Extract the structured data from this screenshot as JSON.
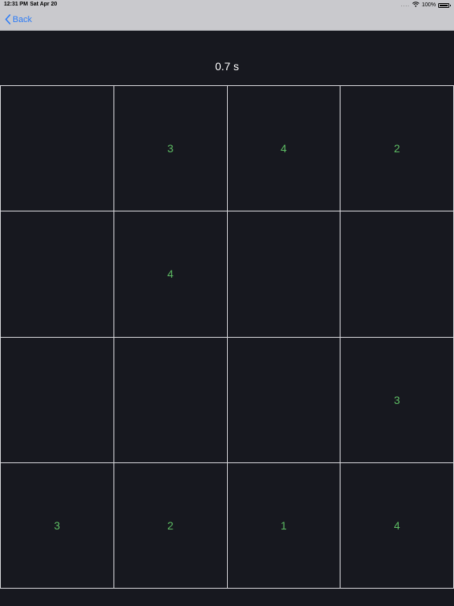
{
  "status_bar": {
    "time": "12:31 PM",
    "date": "Sat Apr 20",
    "dots": "....",
    "battery": "100%"
  },
  "nav": {
    "back_label": "Back"
  },
  "timer": "0.7 s",
  "colors": {
    "background": "#17181f",
    "grid_line": "#d8d8dc",
    "number": "#5dbb63",
    "back_link": "#2d7cf6"
  },
  "grid": [
    [
      "",
      "3",
      "4",
      "2"
    ],
    [
      "",
      "4",
      "",
      ""
    ],
    [
      "",
      "",
      "",
      "3"
    ],
    [
      "3",
      "2",
      "1",
      "4"
    ]
  ]
}
